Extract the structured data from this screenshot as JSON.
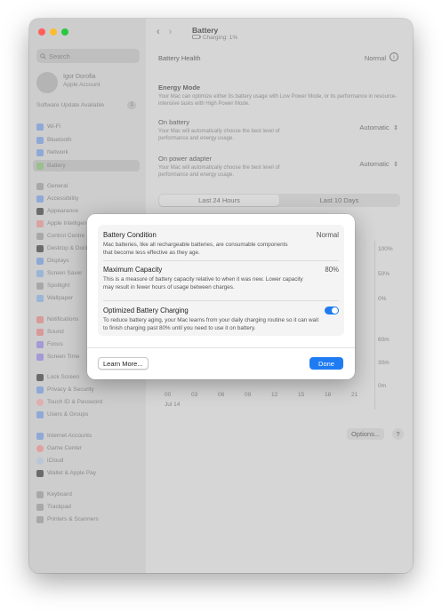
{
  "window": {
    "traffic_lights": {
      "close": "#ff5f57",
      "minimize": "#febc2e",
      "zoom": "#28c840"
    }
  },
  "sidebar": {
    "search_placeholder": "Search",
    "account": {
      "name": "Igor Dorofia",
      "subtitle": "Apple Account"
    },
    "software_update": {
      "label": "Software Update Available",
      "badge": "1"
    },
    "items": [
      {
        "label": "Wi-Fi",
        "icon": "wifi-icon",
        "color": "#8fa9d6"
      },
      {
        "label": "Bluetooth",
        "icon": "bluetooth-icon",
        "color": "#8fa9d6"
      },
      {
        "label": "Network",
        "icon": "network-icon",
        "color": "#8fa9d6"
      },
      {
        "label": "Battery",
        "icon": "battery-icon",
        "color": "#9bbf8f"
      },
      {
        "label": "General",
        "icon": "gear-icon",
        "color": "#a8a8a8"
      },
      {
        "label": "Accessibility",
        "icon": "accessibility-icon",
        "color": "#8fa9d6"
      },
      {
        "label": "Appearance",
        "icon": "appearance-icon",
        "color": "#6b6b6b"
      },
      {
        "label": "Apple Intelligence",
        "icon": "apple-intelligence-icon",
        "color": "#d9a3a3"
      },
      {
        "label": "Control Centre",
        "icon": "control-centre-icon",
        "color": "#a8a8a8"
      },
      {
        "label": "Desktop & Dock",
        "icon": "desktop-dock-icon",
        "color": "#6b6b6b"
      },
      {
        "label": "Displays",
        "icon": "displays-icon",
        "color": "#8fa9d6"
      },
      {
        "label": "Screen Saver",
        "icon": "screen-saver-icon",
        "color": "#9ab6d6"
      },
      {
        "label": "Spotlight",
        "icon": "spotlight-icon",
        "color": "#a8a8a8"
      },
      {
        "label": "Wallpaper",
        "icon": "wallpaper-icon",
        "color": "#9ab6d6"
      },
      {
        "label": "Notifications",
        "icon": "notifications-icon",
        "color": "#d99a9a"
      },
      {
        "label": "Sound",
        "icon": "sound-icon",
        "color": "#d99a9a"
      },
      {
        "label": "Focus",
        "icon": "focus-icon",
        "color": "#a39ad6"
      },
      {
        "label": "Screen Time",
        "icon": "screen-time-icon",
        "color": "#a39ad6"
      },
      {
        "label": "Lock Screen",
        "icon": "lock-icon",
        "color": "#6b6b6b"
      },
      {
        "label": "Privacy & Security",
        "icon": "privacy-icon",
        "color": "#8fa9d6"
      },
      {
        "label": "Touch ID & Password",
        "icon": "touch-id-icon",
        "color": "#e0b0b0"
      },
      {
        "label": "Users & Groups",
        "icon": "users-icon",
        "color": "#8fa9d6"
      },
      {
        "label": "Internet Accounts",
        "icon": "internet-accounts-icon",
        "color": "#8fa9d6"
      },
      {
        "label": "Game Center",
        "icon": "game-center-icon",
        "color": "#e0a0a0"
      },
      {
        "label": "iCloud",
        "icon": "icloud-icon",
        "color": "#b8c6d8"
      },
      {
        "label": "Wallet & Apple Pay",
        "icon": "wallet-icon",
        "color": "#6b6b6b"
      },
      {
        "label": "Keyboard",
        "icon": "keyboard-icon",
        "color": "#a8a8a8"
      },
      {
        "label": "Trackpad",
        "icon": "trackpad-icon",
        "color": "#a8a8a8"
      },
      {
        "label": "Printers & Scanners",
        "icon": "printer-icon",
        "color": "#a8a8a8"
      }
    ]
  },
  "header": {
    "back_glyph": "‹",
    "forward_glyph": "›",
    "title": "Battery",
    "subtitle": "Charging: 1%"
  },
  "main": {
    "battery_health": {
      "label": "Battery Health",
      "value": "Normal",
      "info_glyph": "i"
    },
    "energy_mode": {
      "title": "Energy Mode",
      "description": "Your Mac can optimize either its battery usage with Low Power Mode, or its performance in resource-intensive tasks with High Power Mode."
    },
    "on_battery": {
      "label": "On battery",
      "description": "Your Mac will automatically choose the best level of performance and energy usage.",
      "value": "Automatic"
    },
    "on_power_adapter": {
      "label": "On power adapter",
      "description": "Your Mac will automatically choose the best level of performance and energy usage.",
      "value": "Automatic"
    },
    "segmented": {
      "tab1": "Last 24 Hours",
      "tab2": "Last 10 Days"
    },
    "chart": {
      "y_labels_top": [
        "100%",
        "50%",
        "0%"
      ],
      "y_labels_bottom": [
        "60m",
        "30m",
        "0m"
      ],
      "x_labels": [
        "00",
        "03",
        "06",
        "09",
        "12",
        "15",
        "18",
        "21"
      ],
      "date": "Jul 14"
    },
    "options_button": "Options...",
    "help_glyph": "?"
  },
  "modal": {
    "battery_condition": {
      "title": "Battery Condition",
      "value": "Normal",
      "description": "Mac batteries, like all rechargeable batteries, are consumable components that become less effective as they age."
    },
    "maximum_capacity": {
      "title": "Maximum Capacity",
      "value": "80%",
      "description": "This is a measure of battery capacity relative to when it was new. Lower capacity may result in fewer hours of usage between charges."
    },
    "optimized_charging": {
      "title": "Optimized Battery Charging",
      "enabled": true,
      "description": "To reduce battery aging, your Mac learns from your daily charging routine so it can wait to finish charging past 80% until you need to use it on battery."
    },
    "learn_more": "Learn More...",
    "done": "Done",
    "accent_color": "#1f7bf2"
  }
}
